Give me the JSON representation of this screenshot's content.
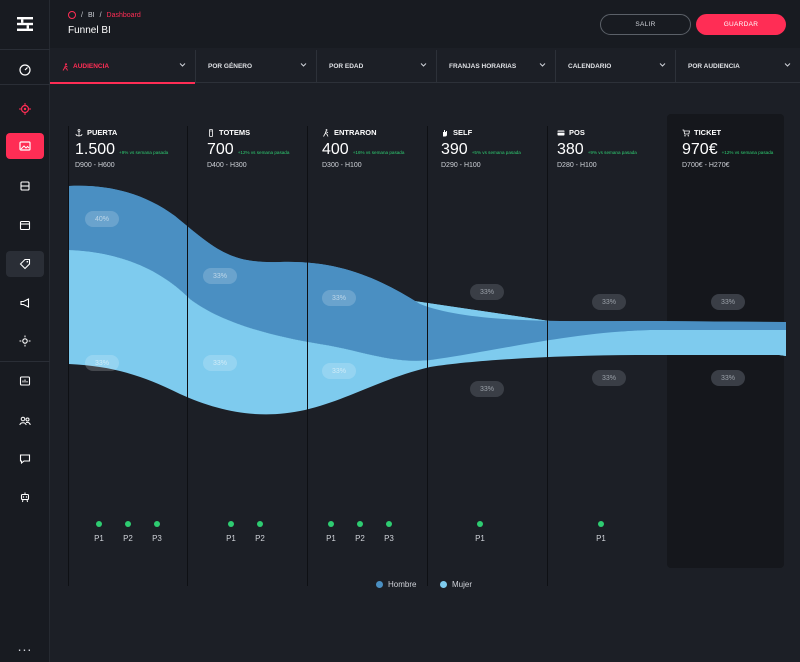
{
  "breadcrumb": {
    "level1": "BI",
    "current": "Dashboard"
  },
  "page_title": "Funnel BI",
  "buttons": {
    "salir": "SALIR",
    "guardar": "GUARDAR"
  },
  "tabs": [
    {
      "label": "AUDIENCIA",
      "active": true
    },
    {
      "label": "POR GÉNERO",
      "active": false
    },
    {
      "label": "POR EDAD",
      "active": false
    },
    {
      "label": "FRANJAS HORARIAS",
      "active": false
    },
    {
      "label": "CALENDARIO",
      "active": false
    },
    {
      "label": "POR AUDIENCIA",
      "active": false
    }
  ],
  "colors": {
    "accent": "#ff2d55",
    "hombre": "#4a8fc2",
    "mujer": "#7ecbee",
    "positive": "#2ecc71"
  },
  "stages": [
    {
      "name": "PUERTA",
      "icon": "anchor-icon",
      "value": "1.500",
      "delta": "+9% vs semana pasada",
      "range": "D900 - H600",
      "hombre_pct": "40%",
      "mujer_pct": "33%",
      "points": [
        "P1",
        "P2",
        "P3"
      ]
    },
    {
      "name": "TOTEMS",
      "icon": "totem-icon",
      "value": "700",
      "delta": "+12% vs semana pasada",
      "range": "D400 - H300",
      "hombre_pct": "33%",
      "mujer_pct": "33%",
      "points": [
        "P1",
        "P2"
      ]
    },
    {
      "name": "ENTRARON",
      "icon": "walking-icon",
      "value": "400",
      "delta": "+16% vs semana pasada",
      "range": "D300 - H100",
      "hombre_pct": "33%",
      "mujer_pct": "33%",
      "points": [
        "P1",
        "P2",
        "P3"
      ]
    },
    {
      "name": "SELF",
      "icon": "hand-icon",
      "value": "390",
      "delta": "+5% vs semana pasada",
      "range": "D290 - H100",
      "hombre_pct": "33%",
      "mujer_pct": "33%",
      "points": [
        "P1"
      ]
    },
    {
      "name": "POS",
      "icon": "card-icon",
      "value": "380",
      "delta": "+9% vs semana pasada",
      "range": "D280 - H100",
      "hombre_pct": "33%",
      "mujer_pct": "33%",
      "points": [
        "P1"
      ]
    },
    {
      "name": "TICKET",
      "icon": "cart-icon",
      "value": "970€",
      "delta": "+12% vs semana pasada",
      "range": "D700€ - H270€",
      "hombre_pct": "33%",
      "mujer_pct": "33%",
      "points": []
    }
  ],
  "legend": {
    "hombre": "Hombre",
    "mujer": "Mujer"
  },
  "sidebar": {
    "items": [
      {
        "icon": "dashboard-icon"
      },
      {
        "icon": "target-icon"
      },
      {
        "icon": "image-icon",
        "active": true
      },
      {
        "icon": "inbox-icon"
      },
      {
        "icon": "calendar-icon"
      },
      {
        "icon": "tag-icon",
        "hover": true
      },
      {
        "icon": "megaphone-icon"
      },
      {
        "icon": "sun-icon"
      },
      {
        "icon": "report-icon"
      },
      {
        "icon": "users-icon"
      },
      {
        "icon": "chat-icon"
      },
      {
        "icon": "robot-icon"
      }
    ],
    "more": "..."
  }
}
